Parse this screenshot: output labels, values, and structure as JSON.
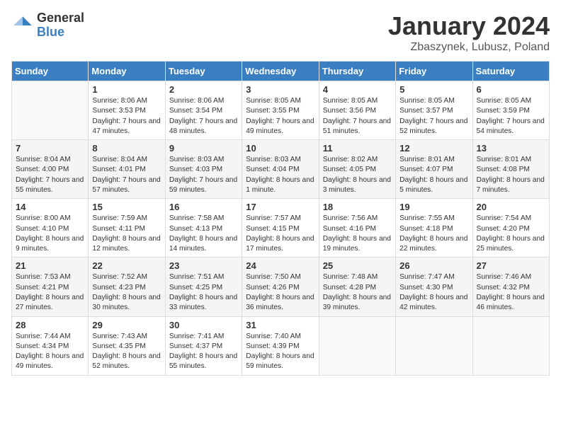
{
  "header": {
    "logo": {
      "general": "General",
      "blue": "Blue"
    },
    "title": "January 2024",
    "location": "Zbaszynek, Lubusz, Poland"
  },
  "weekdays": [
    "Sunday",
    "Monday",
    "Tuesday",
    "Wednesday",
    "Thursday",
    "Friday",
    "Saturday"
  ],
  "weeks": [
    [
      {
        "day": "",
        "empty": true
      },
      {
        "day": "1",
        "sunrise": "Sunrise: 8:06 AM",
        "sunset": "Sunset: 3:53 PM",
        "daylight": "Daylight: 7 hours and 47 minutes."
      },
      {
        "day": "2",
        "sunrise": "Sunrise: 8:06 AM",
        "sunset": "Sunset: 3:54 PM",
        "daylight": "Daylight: 7 hours and 48 minutes."
      },
      {
        "day": "3",
        "sunrise": "Sunrise: 8:05 AM",
        "sunset": "Sunset: 3:55 PM",
        "daylight": "Daylight: 7 hours and 49 minutes."
      },
      {
        "day": "4",
        "sunrise": "Sunrise: 8:05 AM",
        "sunset": "Sunset: 3:56 PM",
        "daylight": "Daylight: 7 hours and 51 minutes."
      },
      {
        "day": "5",
        "sunrise": "Sunrise: 8:05 AM",
        "sunset": "Sunset: 3:57 PM",
        "daylight": "Daylight: 7 hours and 52 minutes."
      },
      {
        "day": "6",
        "sunrise": "Sunrise: 8:05 AM",
        "sunset": "Sunset: 3:59 PM",
        "daylight": "Daylight: 7 hours and 54 minutes."
      }
    ],
    [
      {
        "day": "7",
        "sunrise": "Sunrise: 8:04 AM",
        "sunset": "Sunset: 4:00 PM",
        "daylight": "Daylight: 7 hours and 55 minutes."
      },
      {
        "day": "8",
        "sunrise": "Sunrise: 8:04 AM",
        "sunset": "Sunset: 4:01 PM",
        "daylight": "Daylight: 7 hours and 57 minutes."
      },
      {
        "day": "9",
        "sunrise": "Sunrise: 8:03 AM",
        "sunset": "Sunset: 4:03 PM",
        "daylight": "Daylight: 7 hours and 59 minutes."
      },
      {
        "day": "10",
        "sunrise": "Sunrise: 8:03 AM",
        "sunset": "Sunset: 4:04 PM",
        "daylight": "Daylight: 8 hours and 1 minute."
      },
      {
        "day": "11",
        "sunrise": "Sunrise: 8:02 AM",
        "sunset": "Sunset: 4:05 PM",
        "daylight": "Daylight: 8 hours and 3 minutes."
      },
      {
        "day": "12",
        "sunrise": "Sunrise: 8:01 AM",
        "sunset": "Sunset: 4:07 PM",
        "daylight": "Daylight: 8 hours and 5 minutes."
      },
      {
        "day": "13",
        "sunrise": "Sunrise: 8:01 AM",
        "sunset": "Sunset: 4:08 PM",
        "daylight": "Daylight: 8 hours and 7 minutes."
      }
    ],
    [
      {
        "day": "14",
        "sunrise": "Sunrise: 8:00 AM",
        "sunset": "Sunset: 4:10 PM",
        "daylight": "Daylight: 8 hours and 9 minutes."
      },
      {
        "day": "15",
        "sunrise": "Sunrise: 7:59 AM",
        "sunset": "Sunset: 4:11 PM",
        "daylight": "Daylight: 8 hours and 12 minutes."
      },
      {
        "day": "16",
        "sunrise": "Sunrise: 7:58 AM",
        "sunset": "Sunset: 4:13 PM",
        "daylight": "Daylight: 8 hours and 14 minutes."
      },
      {
        "day": "17",
        "sunrise": "Sunrise: 7:57 AM",
        "sunset": "Sunset: 4:15 PM",
        "daylight": "Daylight: 8 hours and 17 minutes."
      },
      {
        "day": "18",
        "sunrise": "Sunrise: 7:56 AM",
        "sunset": "Sunset: 4:16 PM",
        "daylight": "Daylight: 8 hours and 19 minutes."
      },
      {
        "day": "19",
        "sunrise": "Sunrise: 7:55 AM",
        "sunset": "Sunset: 4:18 PM",
        "daylight": "Daylight: 8 hours and 22 minutes."
      },
      {
        "day": "20",
        "sunrise": "Sunrise: 7:54 AM",
        "sunset": "Sunset: 4:20 PM",
        "daylight": "Daylight: 8 hours and 25 minutes."
      }
    ],
    [
      {
        "day": "21",
        "sunrise": "Sunrise: 7:53 AM",
        "sunset": "Sunset: 4:21 PM",
        "daylight": "Daylight: 8 hours and 27 minutes."
      },
      {
        "day": "22",
        "sunrise": "Sunrise: 7:52 AM",
        "sunset": "Sunset: 4:23 PM",
        "daylight": "Daylight: 8 hours and 30 minutes."
      },
      {
        "day": "23",
        "sunrise": "Sunrise: 7:51 AM",
        "sunset": "Sunset: 4:25 PM",
        "daylight": "Daylight: 8 hours and 33 minutes."
      },
      {
        "day": "24",
        "sunrise": "Sunrise: 7:50 AM",
        "sunset": "Sunset: 4:26 PM",
        "daylight": "Daylight: 8 hours and 36 minutes."
      },
      {
        "day": "25",
        "sunrise": "Sunrise: 7:48 AM",
        "sunset": "Sunset: 4:28 PM",
        "daylight": "Daylight: 8 hours and 39 minutes."
      },
      {
        "day": "26",
        "sunrise": "Sunrise: 7:47 AM",
        "sunset": "Sunset: 4:30 PM",
        "daylight": "Daylight: 8 hours and 42 minutes."
      },
      {
        "day": "27",
        "sunrise": "Sunrise: 7:46 AM",
        "sunset": "Sunset: 4:32 PM",
        "daylight": "Daylight: 8 hours and 46 minutes."
      }
    ],
    [
      {
        "day": "28",
        "sunrise": "Sunrise: 7:44 AM",
        "sunset": "Sunset: 4:34 PM",
        "daylight": "Daylight: 8 hours and 49 minutes."
      },
      {
        "day": "29",
        "sunrise": "Sunrise: 7:43 AM",
        "sunset": "Sunset: 4:35 PM",
        "daylight": "Daylight: 8 hours and 52 minutes."
      },
      {
        "day": "30",
        "sunrise": "Sunrise: 7:41 AM",
        "sunset": "Sunset: 4:37 PM",
        "daylight": "Daylight: 8 hours and 55 minutes."
      },
      {
        "day": "31",
        "sunrise": "Sunrise: 7:40 AM",
        "sunset": "Sunset: 4:39 PM",
        "daylight": "Daylight: 8 hours and 59 minutes."
      },
      {
        "day": "",
        "empty": true
      },
      {
        "day": "",
        "empty": true
      },
      {
        "day": "",
        "empty": true
      }
    ]
  ]
}
